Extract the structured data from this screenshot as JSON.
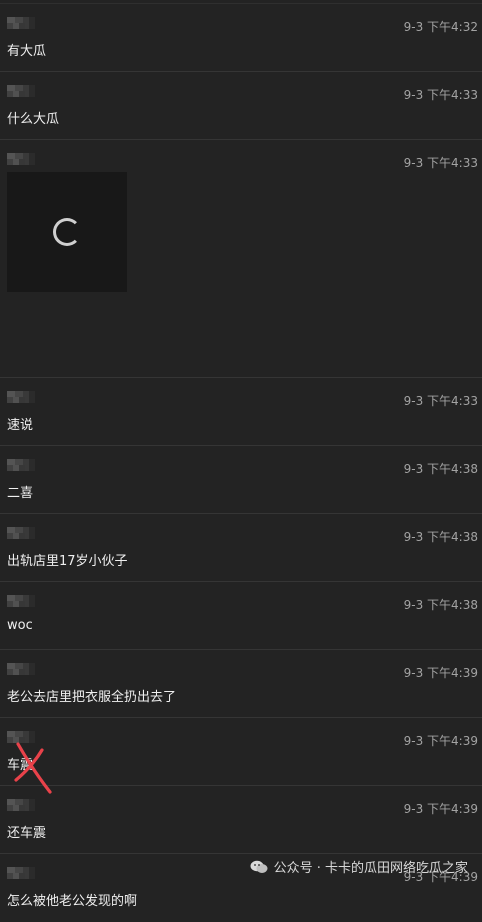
{
  "messages": [
    {
      "time": "9-3 下午4:32",
      "text": "有大瓜"
    },
    {
      "time": "9-3 下午4:33",
      "text": "什么大瓜"
    },
    {
      "time": "9-3 下午4:33",
      "text": "",
      "image": true
    },
    {
      "time": "9-3 下午4:33",
      "text": "速说"
    },
    {
      "time": "9-3 下午4:38",
      "text": "二喜"
    },
    {
      "time": "9-3 下午4:38",
      "text": "出轨店里17岁小伙子"
    },
    {
      "time": "9-3 下午4:38",
      "text": "woc"
    },
    {
      "time": "9-3 下午4:39",
      "text": "老公去店里把衣服全扔出去了"
    },
    {
      "time": "9-3 下午4:39",
      "text": "车震"
    },
    {
      "time": "9-3 下午4:39",
      "text": "还车震"
    },
    {
      "time": "9-3 下午4:39",
      "text": "怎么被他老公发现的啊"
    }
  ],
  "watermark": {
    "text": "公众号 · 卡卡的瓜田网络吃瓜之家",
    "icon": "wechat-icon"
  },
  "colors": {
    "background": "#232323",
    "annotation": "#e8424a"
  }
}
